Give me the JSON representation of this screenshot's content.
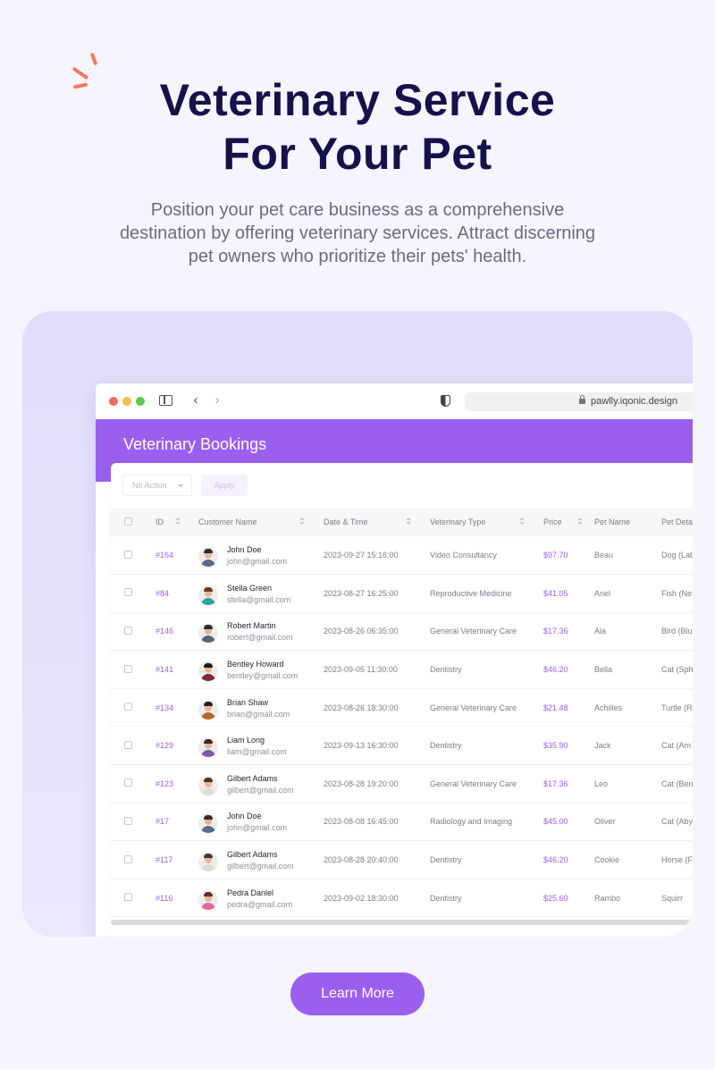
{
  "hero": {
    "title_line1": "Veterinary Service",
    "title_line2": "For Your Pet",
    "description": "Position your pet care business as a comprehensive destination by offering veterinary services. Attract discerning pet owners who prioritize their pets' health."
  },
  "browser": {
    "url": "pawlly.iqonic.design"
  },
  "page": {
    "title": "Veterinary Bookings",
    "bulk_action": "No Action",
    "apply_label": "Apply"
  },
  "table": {
    "columns": [
      "ID",
      "Customer Name",
      "Date & Time",
      "Veterinary Type",
      "Price",
      "Pet Name",
      "Pet Deta"
    ],
    "rows": [
      {
        "id": "#164",
        "name": "John Doe",
        "email": "john@gmail.com",
        "datetime": "2023-09-27 15:16:00",
        "type": "Video Consultancy",
        "price": "$97.70",
        "pet": "Beau",
        "detail": "Dog (Lab"
      },
      {
        "id": "#84",
        "name": "Stella Green",
        "email": "stella@gmail.com",
        "datetime": "2023-08-27 16:25:00",
        "type": "Reproductive Medicine",
        "price": "$41.05",
        "pet": "Ariel",
        "detail": "Fish (Ne"
      },
      {
        "id": "#146",
        "name": "Robert Martin",
        "email": "robert@gmail.com",
        "datetime": "2023-08-26 06:35:00",
        "type": "General Veterinary Care",
        "price": "$17.36",
        "pet": "Ala",
        "detail": "Bird (Blu"
      },
      {
        "id": "#141",
        "name": "Bentley Howard",
        "email": "bentley@gmail.com",
        "datetime": "2023-09-05 11:30:00",
        "type": "Dentistry",
        "price": "$46.20",
        "pet": "Bella",
        "detail": "Cat (Sph"
      },
      {
        "id": "#134",
        "name": "Brian Shaw",
        "email": "brian@gmail.com",
        "datetime": "2023-08-26 18:30:00",
        "type": "General Veterinary Care",
        "price": "$21.48",
        "pet": "Achilles",
        "detail": "Turtle (R"
      },
      {
        "id": "#129",
        "name": "Liam Long",
        "email": "liam@gmail.com",
        "datetime": "2023-09-13 16:30:00",
        "type": "Dentistry",
        "price": "$35.90",
        "pet": "Jack",
        "detail": "Cat (Am"
      },
      {
        "id": "#123",
        "name": "Gilbert Adams",
        "email": "gilbert@gmail.com",
        "datetime": "2023-08-28 19:20:00",
        "type": "General Veterinary Care",
        "price": "$17.36",
        "pet": "Leo",
        "detail": "Cat (Ben"
      },
      {
        "id": "#17",
        "name": "John Doe",
        "email": "john@gmail.com",
        "datetime": "2023-08-08 16:45:00",
        "type": "Radiology and Imaging",
        "price": "$45.00",
        "pet": "Oliver",
        "detail": "Cat (Aby"
      },
      {
        "id": "#117",
        "name": "Gilbert Adams",
        "email": "gilbert@gmail.com",
        "datetime": "2023-08-28 20:40:00",
        "type": "Dentistry",
        "price": "$46.20",
        "pet": "Cookie",
        "detail": "Horse (F"
      },
      {
        "id": "#116",
        "name": "Pedra Danlel",
        "email": "pedra@gmail.com",
        "datetime": "2023-09-02 18:30:00",
        "type": "Dentistry",
        "price": "$25.60",
        "pet": "Rambo",
        "detail": "Squirr"
      }
    ]
  },
  "cta": {
    "label": "Learn More"
  },
  "colors": {
    "accent": "#9b5ff0",
    "title": "#15114a",
    "sparkle": "#f27a5e"
  }
}
